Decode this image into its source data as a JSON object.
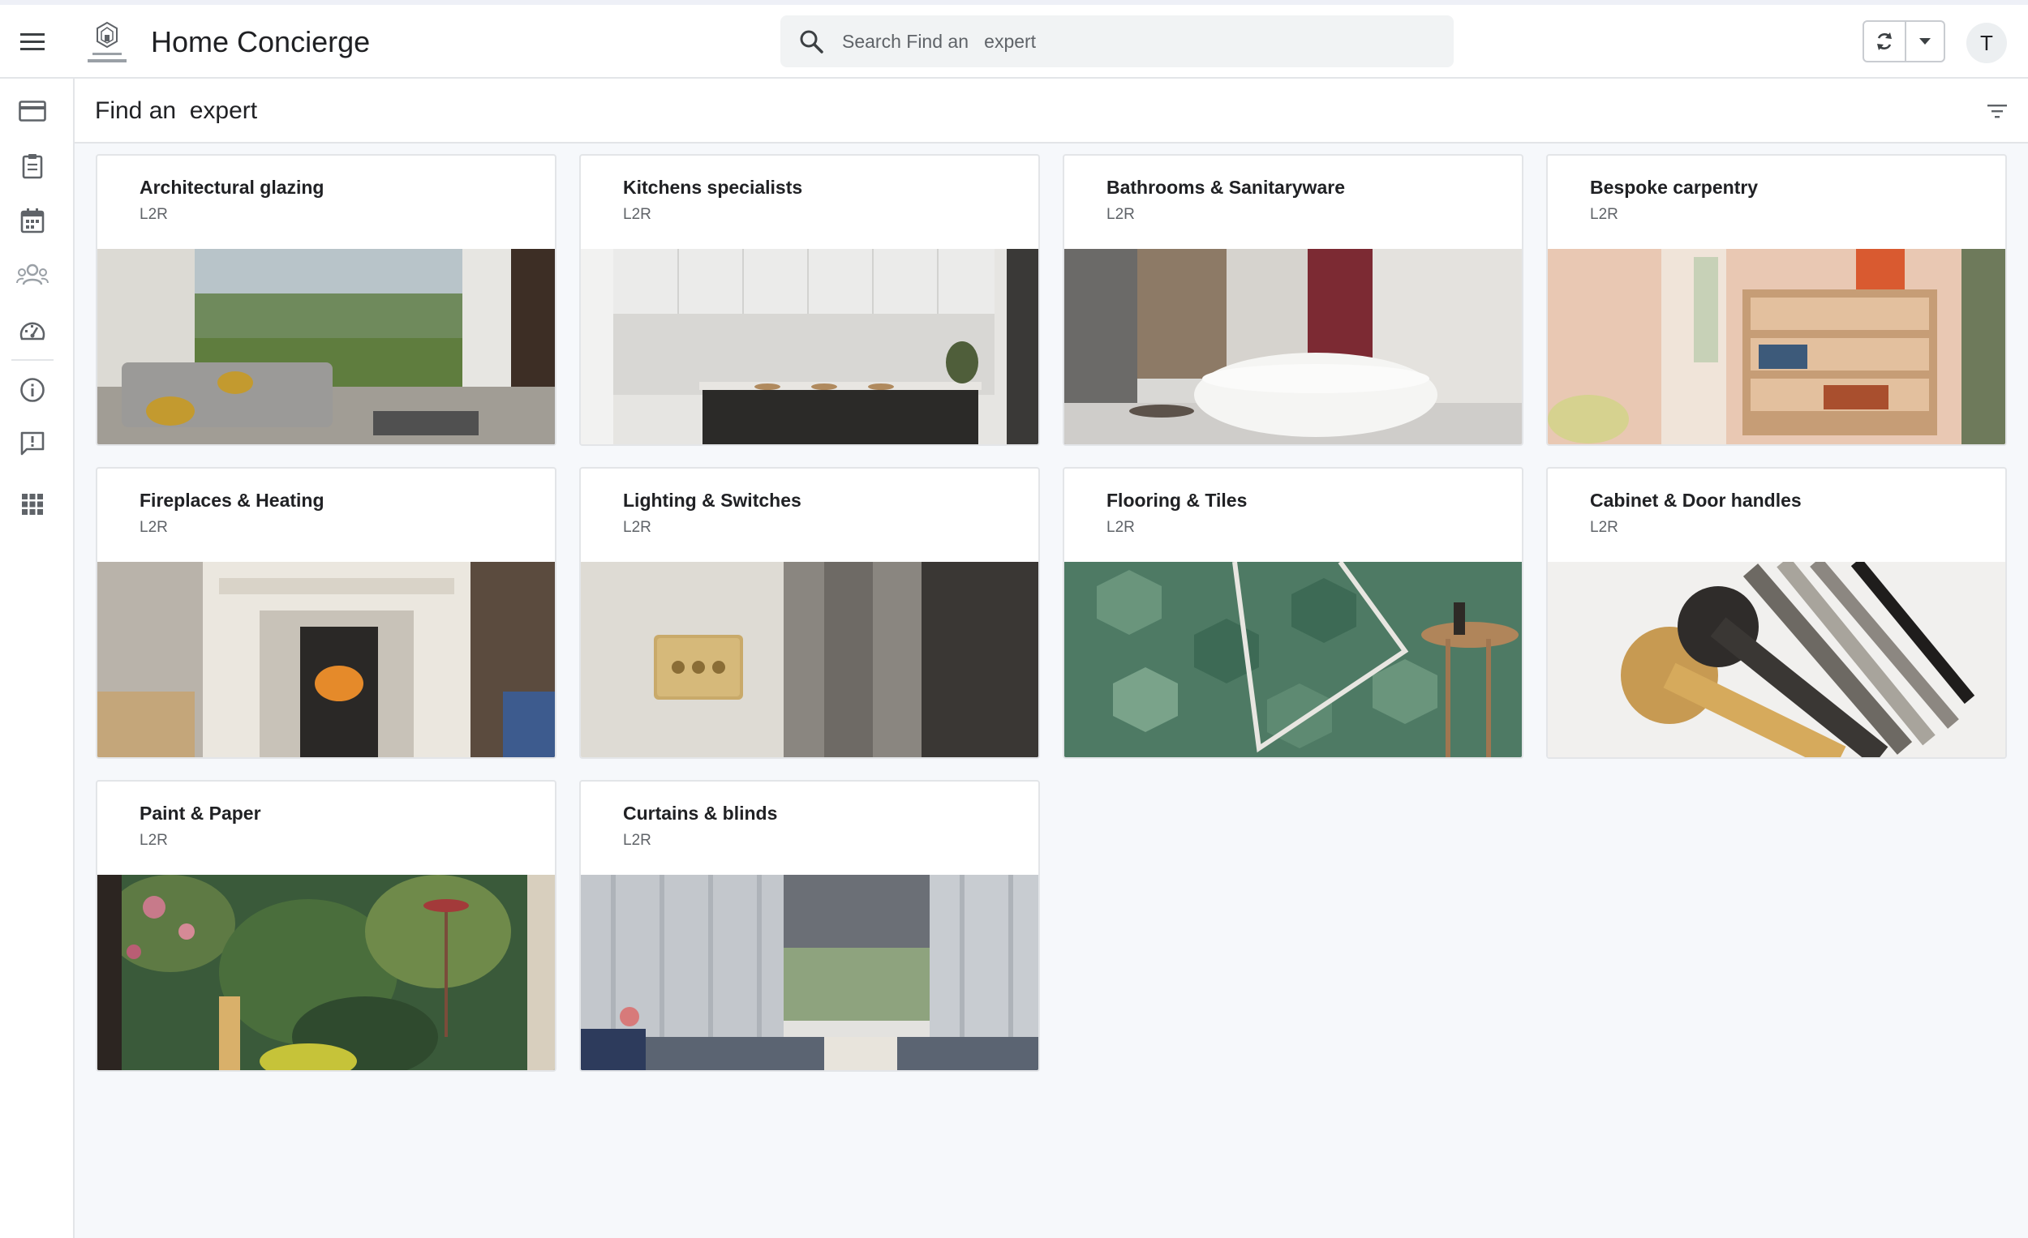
{
  "app": {
    "title": "Home Concierge",
    "logo_name": "love-to-renovate-logo"
  },
  "search": {
    "placeholder": "Search Find an   expert",
    "value": ""
  },
  "user": {
    "initial": "T"
  },
  "page": {
    "title": "Find an  expert"
  },
  "sidebar": {
    "items": [
      {
        "icon": "credit-card-icon"
      },
      {
        "icon": "clipboard-icon"
      },
      {
        "icon": "calendar-icon"
      },
      {
        "icon": "people-icon",
        "active": true
      },
      {
        "icon": "dashboard-gauge-icon"
      },
      {
        "icon": "info-icon"
      },
      {
        "icon": "feedback-icon"
      },
      {
        "icon": "apps-grid-icon"
      }
    ]
  },
  "cards": [
    {
      "title": "Architectural glazing",
      "subtitle": "L2R"
    },
    {
      "title": "Kitchens specialists",
      "subtitle": "L2R"
    },
    {
      "title": "Bathrooms & Sanitaryware",
      "subtitle": "L2R"
    },
    {
      "title": "Bespoke carpentry",
      "subtitle": "L2R"
    },
    {
      "title": "Fireplaces & Heating",
      "subtitle": "L2R"
    },
    {
      "title": "Lighting & Switches",
      "subtitle": "L2R"
    },
    {
      "title": "Flooring & Tiles",
      "subtitle": "L2R"
    },
    {
      "title": "Cabinet & Door handles",
      "subtitle": "L2R"
    },
    {
      "title": "Paint & Paper",
      "subtitle": "L2R"
    },
    {
      "title": "Curtains & blinds",
      "subtitle": "L2R"
    }
  ],
  "colors": {
    "accent": "#202124",
    "muted": "#5f6368",
    "background": "#f6f8fb",
    "border": "#e3e5e8"
  }
}
